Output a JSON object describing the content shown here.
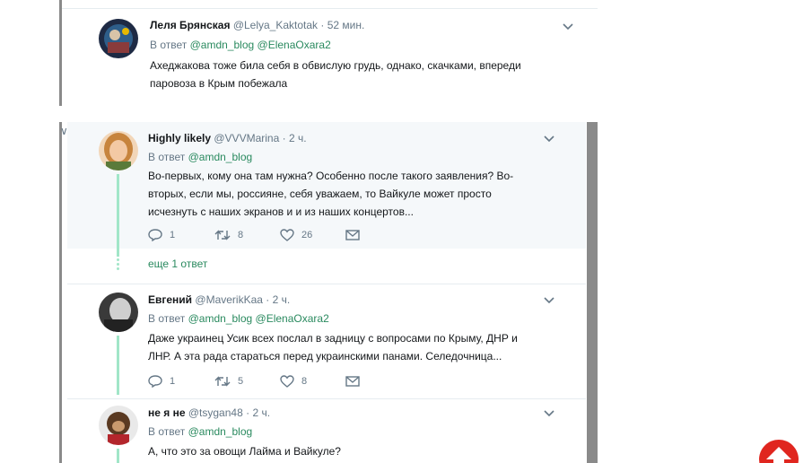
{
  "tweets": [
    {
      "name": "Леля Брянская",
      "handle": "@Lelya_Kaktotak",
      "time": "52 мин.",
      "reply_prefix": "В ответ",
      "mentions": [
        "@amdn_blog",
        "@ElenaOxara2"
      ],
      "text": "Ахеджакова тоже била себя в обвислую грудь, однако, скачками, впереди паровоза в Крым побежала"
    },
    {
      "name": "Highly likely",
      "handle": "@VVVMarina",
      "time": "2 ч.",
      "reply_prefix": "В ответ",
      "mentions": [
        "@amdn_blog"
      ],
      "text": "Во-первых, кому она там нужна? Особенно после такого заявления? Во-вторых, если мы, россияне, себя уважаем, то Вайкуле может просто исчезнуть с наших экранов и и из наших концертов...",
      "replies": "1",
      "retweets": "8",
      "likes": "26"
    },
    {
      "name": "Евгений",
      "handle": "@MaverikKaa",
      "time": "2 ч.",
      "reply_prefix": "В ответ",
      "mentions": [
        "@amdn_blog",
        "@ElenaOxara2"
      ],
      "text": "Даже украинец Усик всех послал в задницу с вопросами по Крыму, ДНР и ЛНР. А эта рада стараться перед украинскими панами. Селедочница...",
      "replies": "1",
      "retweets": "5",
      "likes": "8"
    },
    {
      "name": "не я не",
      "handle": "@tsygan48",
      "time": "2 ч.",
      "reply_prefix": "В ответ",
      "mentions": [
        "@amdn_blog"
      ],
      "text": "А, что это за овощи Лайма и Вайкуле?"
    }
  ],
  "more_replies": "еще 1 ответ",
  "dot_separator": "·",
  "corner_glyph": "∨",
  "icons": {
    "reply": "reply-icon",
    "retweet": "retweet-icon",
    "like": "heart-icon",
    "dm": "envelope-icon",
    "caret": "chevron-down-icon",
    "scroll_top": "arrow-up-icon"
  },
  "colors": {
    "link": "#2a8a5f",
    "thread_line": "#a1e6c8",
    "highlight_bg": "#f5f8fa",
    "scroll_button": "#e0261f",
    "side_bar": "#8a8a8a"
  }
}
